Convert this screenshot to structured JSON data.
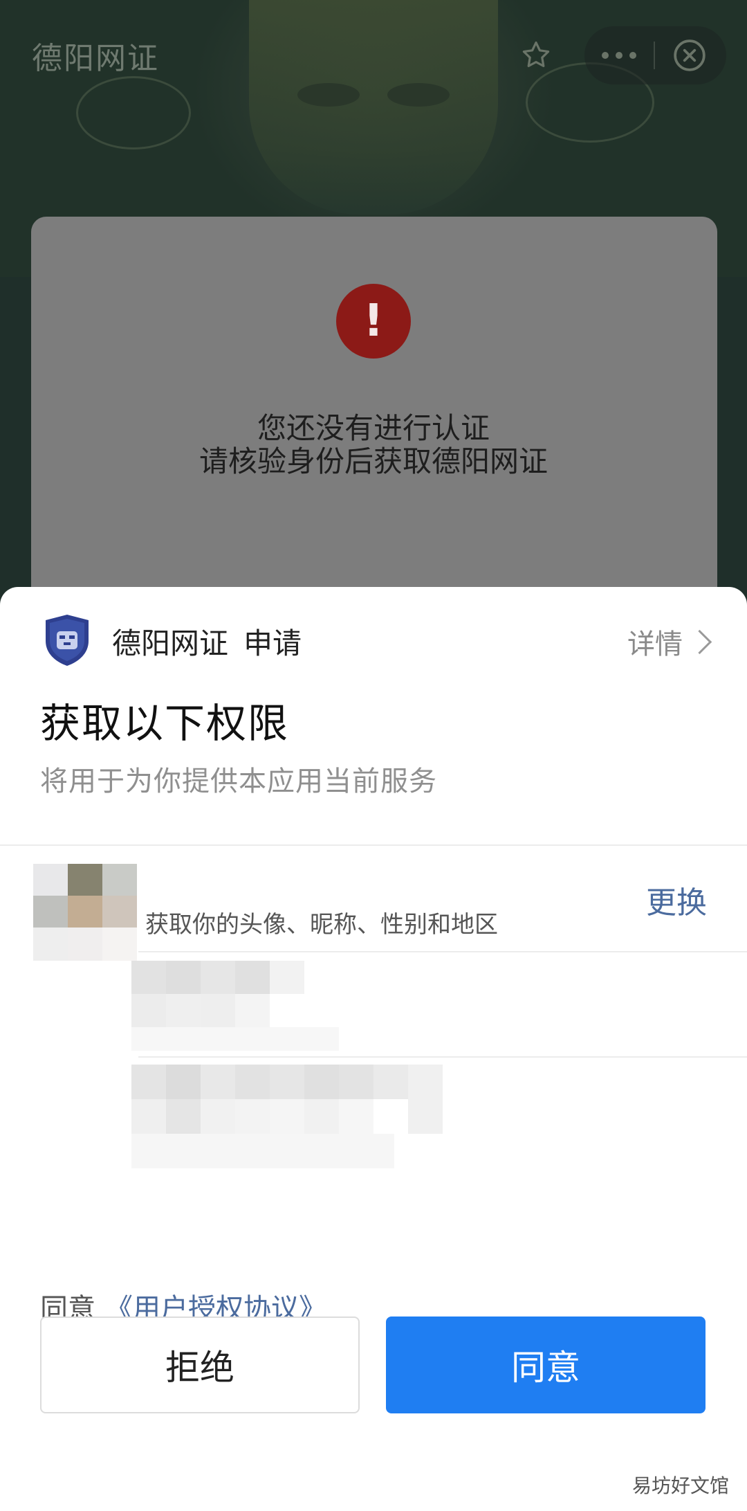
{
  "topbar": {
    "title": "德阳网证",
    "star_icon": "star-icon",
    "more_icon": "more-dots-icon",
    "close_icon": "close-circle-icon"
  },
  "background_card": {
    "warning_icon": "exclamation-icon",
    "warning_symbol": "!",
    "message_line1": "您还没有进行认证",
    "message_line2": "请核验身份后获取德阳网证"
  },
  "sheet": {
    "app_name": "德阳网证",
    "request_label": "申请",
    "detail_label": "详情",
    "title": "获取以下权限",
    "subtitle": "将用于为你提供本应用当前服务",
    "permission_desc": "获取你的头像、昵称、性别和地区",
    "change_label": "更换",
    "agree_prefix": "同意",
    "agreement_link": "《用户授权协议》",
    "reject_button": "拒绝",
    "agree_button": "同意"
  },
  "watermark": "易坊好文馆",
  "colors": {
    "primary": "#1f7ef2",
    "link": "#4b6b9e",
    "warning": "#8c1a17"
  }
}
